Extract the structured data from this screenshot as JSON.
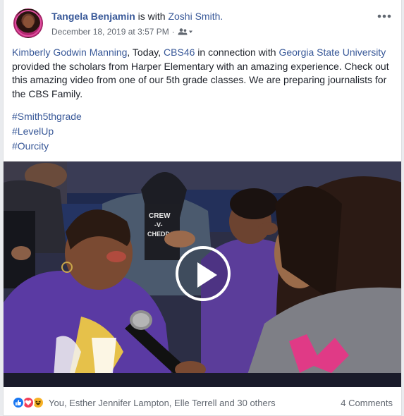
{
  "post": {
    "author": "Tangela Benjamin",
    "with_text": "is with",
    "tagged_person": "Zoshi Smith.",
    "timestamp": "December 18, 2019 at 3:57 PM",
    "separator": "·",
    "audience_icon": "friends-icon",
    "more_icon": "ellipsis-icon"
  },
  "body": {
    "mention_1": "Kimberly Godwin Manning",
    "text_1": ", Today, ",
    "mention_2": "CBS46",
    "text_2": " in connection with ",
    "mention_3": "Georgia State University",
    "text_3": " provided the scholars from Harper Elementary with an amazing experience. Check out this amazing video from one of our 5th grade classes. We are preparing journalists for the CBS Family."
  },
  "hashtags": [
    "#Smith5thgrade",
    "#LevelUp",
    "#Ourcity"
  ],
  "video": {
    "play_icon": "play-icon"
  },
  "footer": {
    "reaction_icons": [
      "like-icon",
      "love-icon",
      "haha-icon"
    ],
    "reaction_text": "You, Esther Jennifer Lampton, Elle Terrell and 30 others",
    "comments_text": "4 Comments"
  }
}
